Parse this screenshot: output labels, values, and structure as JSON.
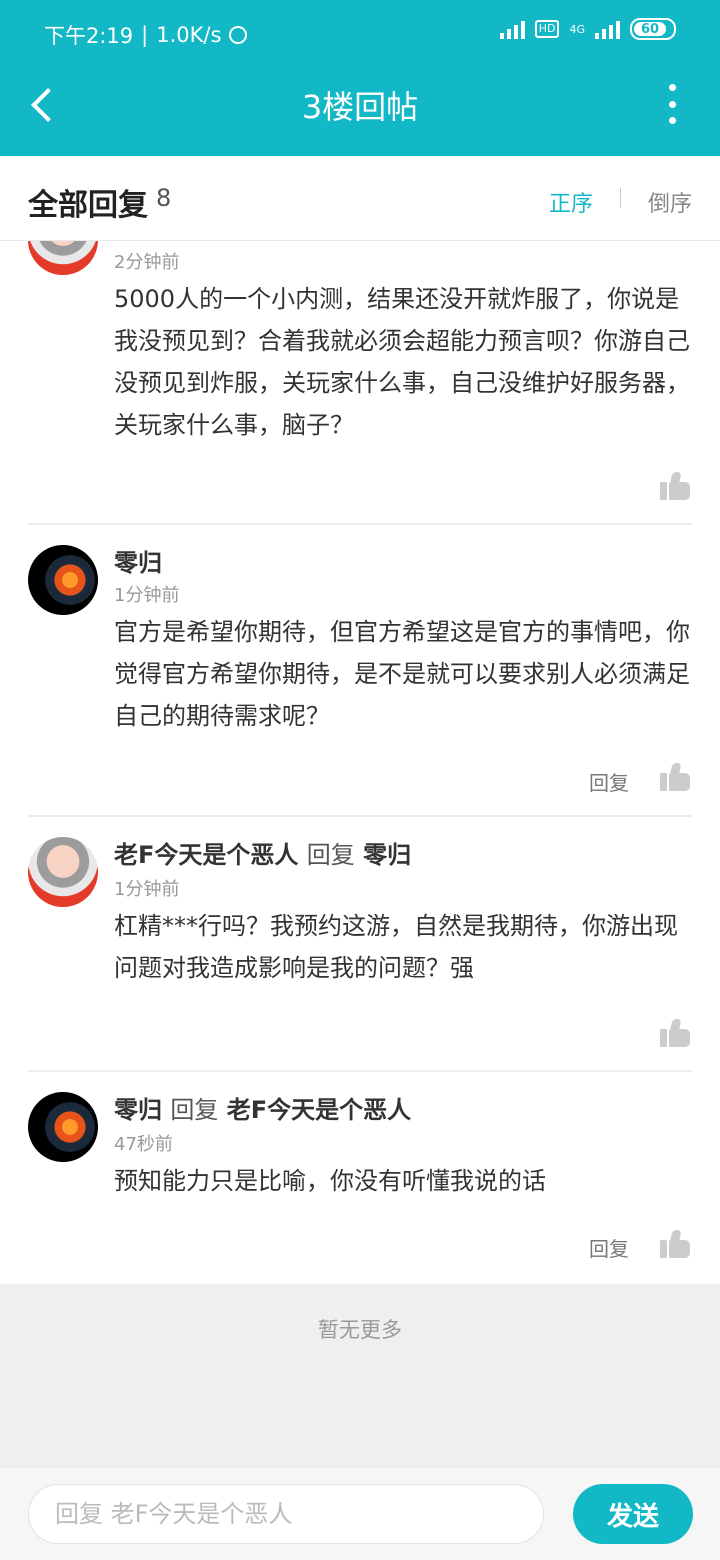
{
  "status_bar": {
    "time": "下午2:19",
    "speed": "1.0K/s",
    "network": "4G",
    "hd": "HD",
    "battery": "60"
  },
  "header": {
    "title": "3楼回帖"
  },
  "subheader": {
    "label": "全部回复",
    "count": "8",
    "sort_asc": "正序",
    "sort_desc": "倒序"
  },
  "comments": [
    {
      "time": "2分钟前",
      "body": "5000人的一个小内测，结果还没开就炸服了，你说是我没预见到？合着我就必须会超能力预言呗？你游自己没预见到炸服，关玩家什么事，自己没维护好服务器，关玩家什么事，脑子？"
    },
    {
      "author": "零归",
      "time": "1分钟前",
      "body": "官方是希望你期待，但官方希望这是官方的事情吧，你觉得官方希望你期待，是不是就可以要求别人必须满足自己的期待需求呢？",
      "reply": "回复"
    },
    {
      "author": "老F今天是个恶人",
      "reply_word": "回复",
      "reply_to": "零归",
      "time": "1分钟前",
      "body": "杠精***行吗？我预约这游，自然是我期待，你游出现问题对我造成影响是我的问题？强"
    },
    {
      "author": "零归",
      "reply_word": "回复",
      "reply_to": "老F今天是个恶人",
      "time": "47秒前",
      "body": "预知能力只是比喻，你没有听懂我说的话",
      "reply": "回复"
    }
  ],
  "footer": {
    "no_more": "暂无更多"
  },
  "composer": {
    "placeholder": "回复 老F今天是个恶人",
    "send_label": "发送"
  }
}
